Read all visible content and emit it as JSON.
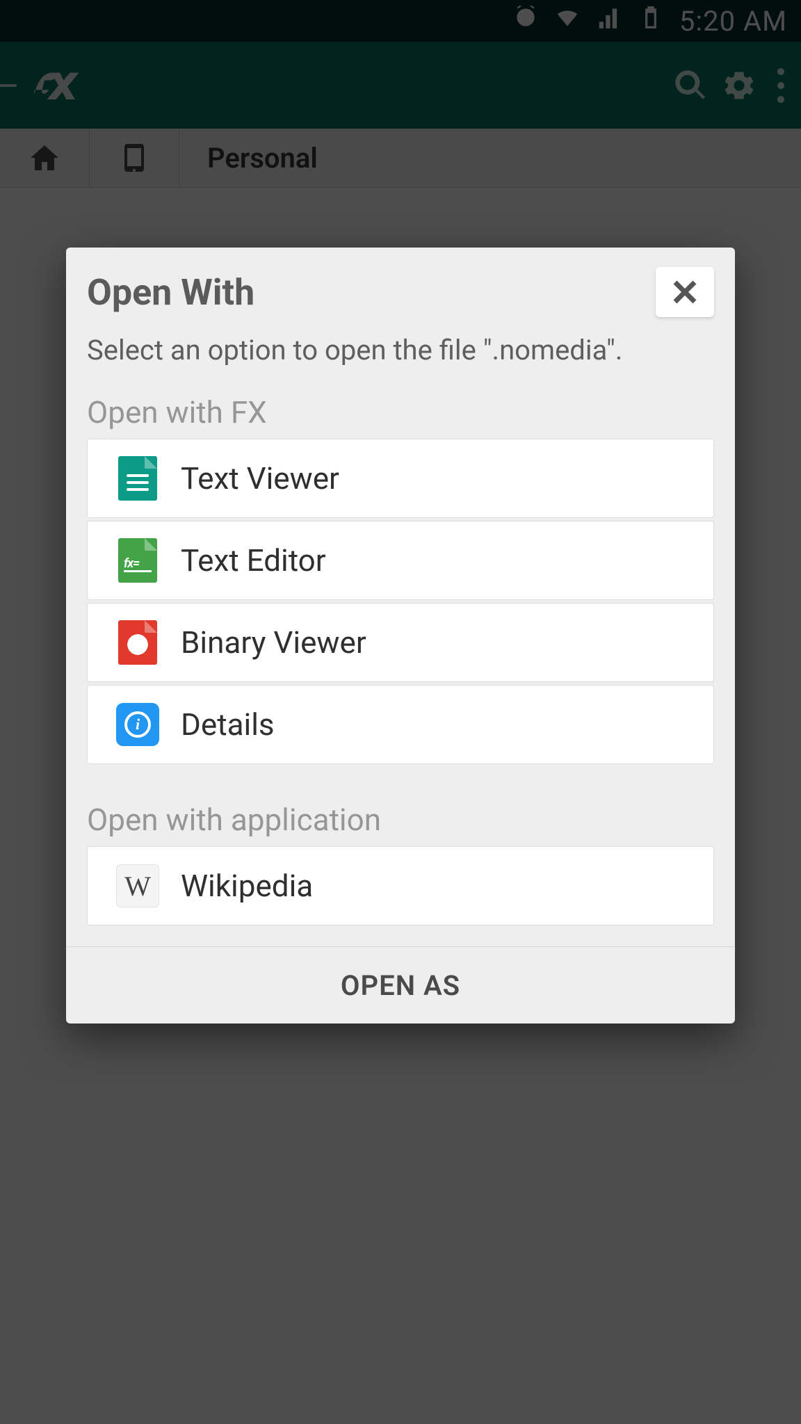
{
  "statusbar": {
    "time": "5:20 AM"
  },
  "appbar": {
    "icons": {
      "search": "search",
      "settings": "settings",
      "more": "more"
    }
  },
  "tabs": {
    "label": "Personal"
  },
  "dialog": {
    "title": "Open With",
    "subtitle": "Select an option to open the file \".nomedia\".",
    "sections": [
      {
        "label": "Open with FX",
        "options": [
          {
            "icon": "text-viewer-icon",
            "label": "Text Viewer"
          },
          {
            "icon": "text-editor-icon",
            "label": "Text Editor"
          },
          {
            "icon": "binary-viewer-icon",
            "label": "Binary Viewer"
          },
          {
            "icon": "details-icon",
            "label": "Details"
          }
        ]
      },
      {
        "label": "Open with application",
        "options": [
          {
            "icon": "wikipedia-icon",
            "label": "Wikipedia"
          }
        ]
      }
    ],
    "footer": "OPEN AS"
  }
}
